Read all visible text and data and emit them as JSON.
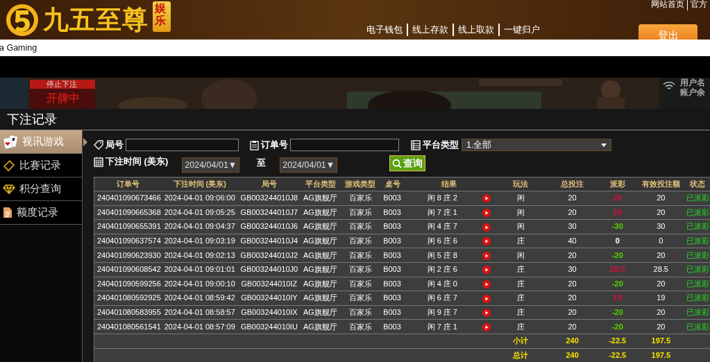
{
  "header": {
    "brand": "九五至尊",
    "badge": "娱乐",
    "top_links": [
      "网站首页",
      "官方"
    ],
    "nav": [
      "电子钱包",
      "线上存款",
      "线上取款",
      "一键归户"
    ],
    "logout": "登出"
  },
  "app_bar": {
    "title": "a Gaming"
  },
  "video_strip": {
    "status": "停止下注",
    "phase": "开牌中",
    "info": [
      "用户名",
      "账户余"
    ]
  },
  "page_title": "下注记录",
  "sidebar": {
    "items": [
      {
        "label": "视讯游戏",
        "selected": true
      },
      {
        "label": "比赛记录",
        "selected": false
      },
      {
        "label": "积分查询",
        "selected": false
      },
      {
        "label": "额度记录",
        "selected": false
      }
    ]
  },
  "filters": {
    "round_label": "局号",
    "order_label": "订单号",
    "platform_label": "平台类型",
    "platform_value": "1.全部",
    "time_label": "下注时间 (美东)",
    "date_from": "2024/04/01▼",
    "to_label": "至",
    "date_to": "2024/04/01▼",
    "search": "查询"
  },
  "table": {
    "columns": [
      "订单号",
      "下注时间 (美东)",
      "局号",
      "平台类型",
      "游戏类型",
      "桌号",
      "结果",
      "玩法",
      "总投注",
      "派彩",
      "有效投注额",
      "状态"
    ],
    "rows": [
      {
        "order": "240401090673466",
        "time": "2024-04-01 09:06:00",
        "round": "GB003244010J8",
        "platform": "AG旗舰厅",
        "game": "百家乐",
        "table": "B003",
        "result": "闲 8 庄 2",
        "play": "闲",
        "bet": "20",
        "payout": "20",
        "color": "#d0103a",
        "valid": "20",
        "status": "已派彩"
      },
      {
        "order": "240401090665368",
        "time": "2024-04-01 09:05:25",
        "round": "GB003244010J7",
        "platform": "AG旗舰厅",
        "game": "百家乐",
        "table": "B003",
        "result": "闲 7 庄 1",
        "play": "闲",
        "bet": "20",
        "payout": "20",
        "color": "#d0103a",
        "valid": "20",
        "status": "已派彩"
      },
      {
        "order": "240401090655391",
        "time": "2024-04-01 09:04:37",
        "round": "GB003244010J6",
        "platform": "AG旗舰厅",
        "game": "百家乐",
        "table": "B003",
        "result": "闲 4 庄 7",
        "play": "闲",
        "bet": "30",
        "payout": "-30",
        "color": "#55d000",
        "valid": "30",
        "status": "已派彩"
      },
      {
        "order": "240401090637574",
        "time": "2024-04-01 09:03:19",
        "round": "GB003244010J4",
        "platform": "AG旗舰厅",
        "game": "百家乐",
        "table": "B003",
        "result": "闲 6 庄 6",
        "play": "庄",
        "bet": "40",
        "payout": "0",
        "color": "#ffffff",
        "valid": "0",
        "status": "已派彩"
      },
      {
        "order": "240401090623930",
        "time": "2024-04-01 09:02:13",
        "round": "GB003244010J2",
        "platform": "AG旗舰厅",
        "game": "百家乐",
        "table": "B003",
        "result": "闲 5 庄 8",
        "play": "闲",
        "bet": "20",
        "payout": "-20",
        "color": "#55d000",
        "valid": "20",
        "status": "已派彩"
      },
      {
        "order": "240401090608542",
        "time": "2024-04-01 09:01:01",
        "round": "GB003244010J0",
        "platform": "AG旗舰厅",
        "game": "百家乐",
        "table": "B003",
        "result": "闲 2 庄 6",
        "play": "庄",
        "bet": "30",
        "payout": "28.5",
        "color": "#d0103a",
        "valid": "28.5",
        "status": "已派彩"
      },
      {
        "order": "240401090599256",
        "time": "2024-04-01 09:00:10",
        "round": "GB003244010IZ",
        "platform": "AG旗舰厅",
        "game": "百家乐",
        "table": "B003",
        "result": "闲 4 庄 0",
        "play": "庄",
        "bet": "20",
        "payout": "-20",
        "color": "#55d000",
        "valid": "20",
        "status": "已派彩"
      },
      {
        "order": "240401080592925",
        "time": "2024-04-01 08:59:42",
        "round": "GB003244010IY",
        "platform": "AG旗舰厅",
        "game": "百家乐",
        "table": "B003",
        "result": "闲 6 庄 7",
        "play": "庄",
        "bet": "20",
        "payout": "19",
        "color": "#d0103a",
        "valid": "19",
        "status": "已派彩"
      },
      {
        "order": "240401080583955",
        "time": "2024-04-01 08:58:57",
        "round": "GB003244010IX",
        "platform": "AG旗舰厅",
        "game": "百家乐",
        "table": "B003",
        "result": "闲 9 庄 7",
        "play": "庄",
        "bet": "20",
        "payout": "-20",
        "color": "#55d000",
        "valid": "20",
        "status": "已派彩"
      },
      {
        "order": "240401080561541",
        "time": "2024-04-01 08:57:09",
        "round": "GB003244010IU",
        "platform": "AG旗舰厅",
        "game": "百家乐",
        "table": "B003",
        "result": "闲 7 庄 1",
        "play": "庄",
        "bet": "20",
        "payout": "-20",
        "color": "#55d000",
        "valid": "20",
        "status": "已派彩"
      }
    ],
    "totals": [
      {
        "label": "小计",
        "bet": "240",
        "payout": "-22.5",
        "valid": "197.5"
      },
      {
        "label": "总计",
        "bet": "240",
        "payout": "-22.5",
        "valid": "197.5"
      }
    ]
  }
}
